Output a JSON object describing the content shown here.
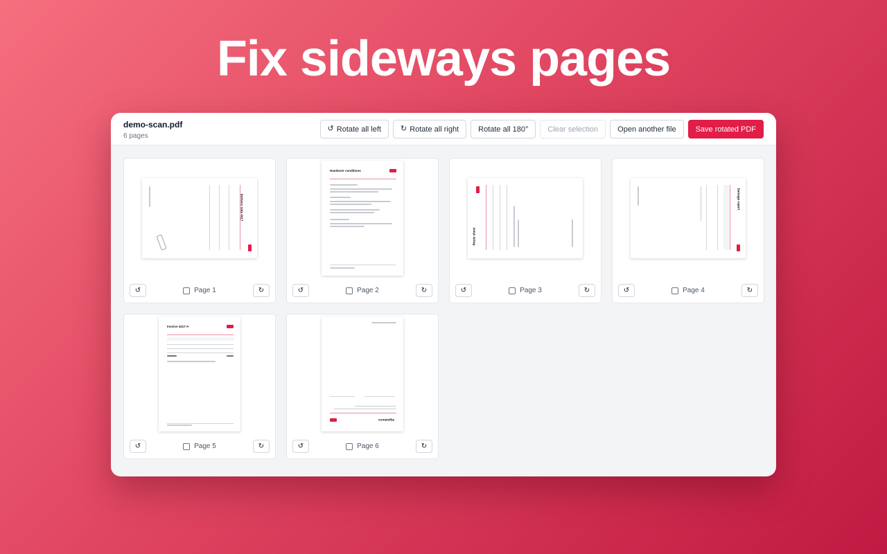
{
  "headline": "Fix sideways pages",
  "file": {
    "name": "demo-scan.pdf",
    "pages_label": "6 pages"
  },
  "toolbar": {
    "rotate_left": "Rotate all left",
    "rotate_right": "Rotate all right",
    "rotate_180": "Rotate all 180°",
    "clear_selection": "Clear selection",
    "open_another": "Open another file",
    "save": "Save rotated PDF"
  },
  "pages": [
    {
      "label": "Page 1",
      "doc_title": "Delivery note 4417"
    },
    {
      "label": "Page 2",
      "doc_title": "Handover conditions"
    },
    {
      "label": "Page 3",
      "doc_title": "Route sheet"
    },
    {
      "label": "Page 4",
      "doc_title": "Damage report"
    },
    {
      "label": "Page 5",
      "doc_title": "Invoice 4417-A"
    },
    {
      "label": "Page 6",
      "doc_title": "Signatures"
    }
  ],
  "icons": {
    "rotate_left": "rotate-ccw-icon",
    "rotate_right": "rotate-cw-icon"
  },
  "colors": {
    "accent": "#e11d48"
  }
}
